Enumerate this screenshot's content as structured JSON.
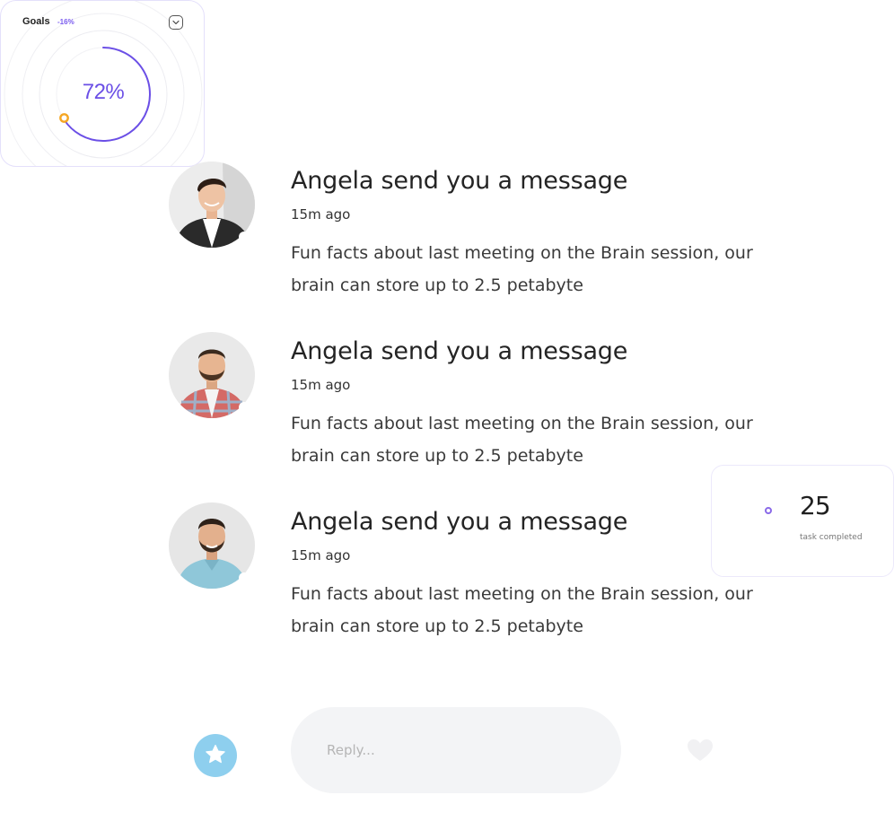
{
  "goals": {
    "title": "Goals",
    "delta": "-16%",
    "percent_label": "72%",
    "progress": 0.72,
    "accent_color": "#6b4fe6",
    "marker_color": "#f5a623"
  },
  "messages": [
    {
      "title": "Angela send you a message",
      "time": "15m ago",
      "body": "Fun facts about last meeting on the Brain session, our brain can store up to 2.5 petabyte",
      "avatar": "man-dark-suit-avatar"
    },
    {
      "title": "Angela send you a message",
      "time": "15m ago",
      "body": "Fun facts about last meeting on the Brain session, our brain can store up to 2.5 petabyte",
      "avatar": "man-plaid-shirt-avatar"
    },
    {
      "title": "Angela send you a message",
      "time": "15m ago",
      "body": "Fun facts about last meeting on the Brain session, our brain can store up to 2.5 petabyte",
      "avatar": "man-blue-shirt-avatar"
    }
  ],
  "task_card": {
    "count": "25",
    "label": "task completed"
  },
  "reply": {
    "placeholder": "Reply...",
    "star_icon": "star-icon",
    "heart_icon": "heart-icon"
  }
}
